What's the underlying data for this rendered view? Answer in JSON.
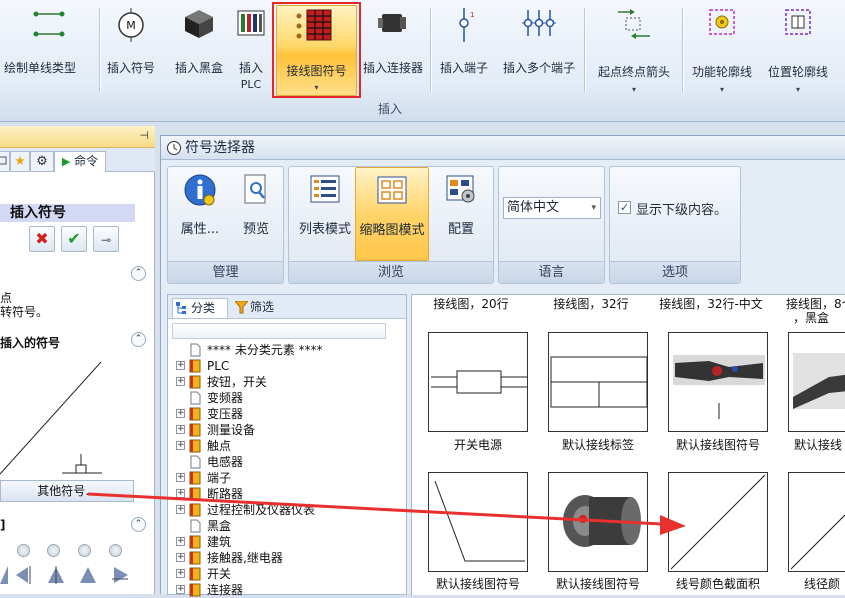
{
  "ribbon": {
    "buttons": {
      "draw_single_line_type": "绘制单线类型",
      "insert_symbol": "插入符号",
      "insert_blackbox": "插入黑盒",
      "insert_plc_line1": "插入",
      "insert_plc_line2": "PLC",
      "wiring_symbol": "接线图符号",
      "insert_connector": "插入连接器",
      "insert_terminal": "插入端子",
      "insert_multi_terminal": "插入多个端子",
      "start_end_arrow": "起点终点箭头",
      "function_outline": "功能轮廓线",
      "location_outline": "位置轮廓线"
    },
    "group_label": "插入"
  },
  "left_panel": {
    "tab_command": "命令",
    "heading": "插入符号",
    "text_line1": "点",
    "text_line2": "转符号。",
    "section_symbol": "插入的符号",
    "other_symbols_button": "其他符号..."
  },
  "selector": {
    "title": "符号选择器",
    "ribbon": {
      "properties": "属性...",
      "preview": "预览",
      "list_mode": "列表模式",
      "thumbnail_mode": "缩略图模式",
      "config": "配置",
      "language_value": "简体中文",
      "show_sublevel": "显示下级内容。",
      "group_manage": "管理",
      "group_browse": "浏览",
      "group_language": "语言",
      "group_options": "选项"
    },
    "tree": {
      "tab_category": "分类",
      "tab_filter": "筛选",
      "items": [
        {
          "label": "**** 未分类元素 ****",
          "folder": false
        },
        {
          "label": "PLC",
          "folder": true
        },
        {
          "label": "按钮，开关",
          "folder": true
        },
        {
          "label": "变频器",
          "folder": false
        },
        {
          "label": "变压器",
          "folder": true
        },
        {
          "label": "测量设备",
          "folder": true
        },
        {
          "label": "触点",
          "folder": true
        },
        {
          "label": "电感器",
          "folder": false
        },
        {
          "label": "端子",
          "folder": true
        },
        {
          "label": "断路器",
          "folder": true
        },
        {
          "label": "过程控制及仪器仪表",
          "folder": true
        },
        {
          "label": "黑盒",
          "folder": false
        },
        {
          "label": "建筑",
          "folder": true
        },
        {
          "label": "接触器,继电器",
          "folder": true
        },
        {
          "label": "开关",
          "folder": true
        },
        {
          "label": "连接器",
          "folder": true
        }
      ]
    },
    "thumbnails": {
      "top_labels": [
        "接线图，20行",
        "接线图，32行",
        "接线图，32行-中文",
        "接线图，8个",
        "，黑盒"
      ],
      "row1_captions": [
        "开关电源",
        "默认接线标签",
        "默认接线图符号",
        "默认接线"
      ],
      "row2_captions": [
        "默认接线图符号",
        "默认接线图符号",
        "线号颜色截面积",
        "线径颜"
      ]
    }
  },
  "colors": {
    "highlight_red": "#e6262a",
    "active_button": "#ffc13a",
    "arrow_red": "#e8312f"
  }
}
